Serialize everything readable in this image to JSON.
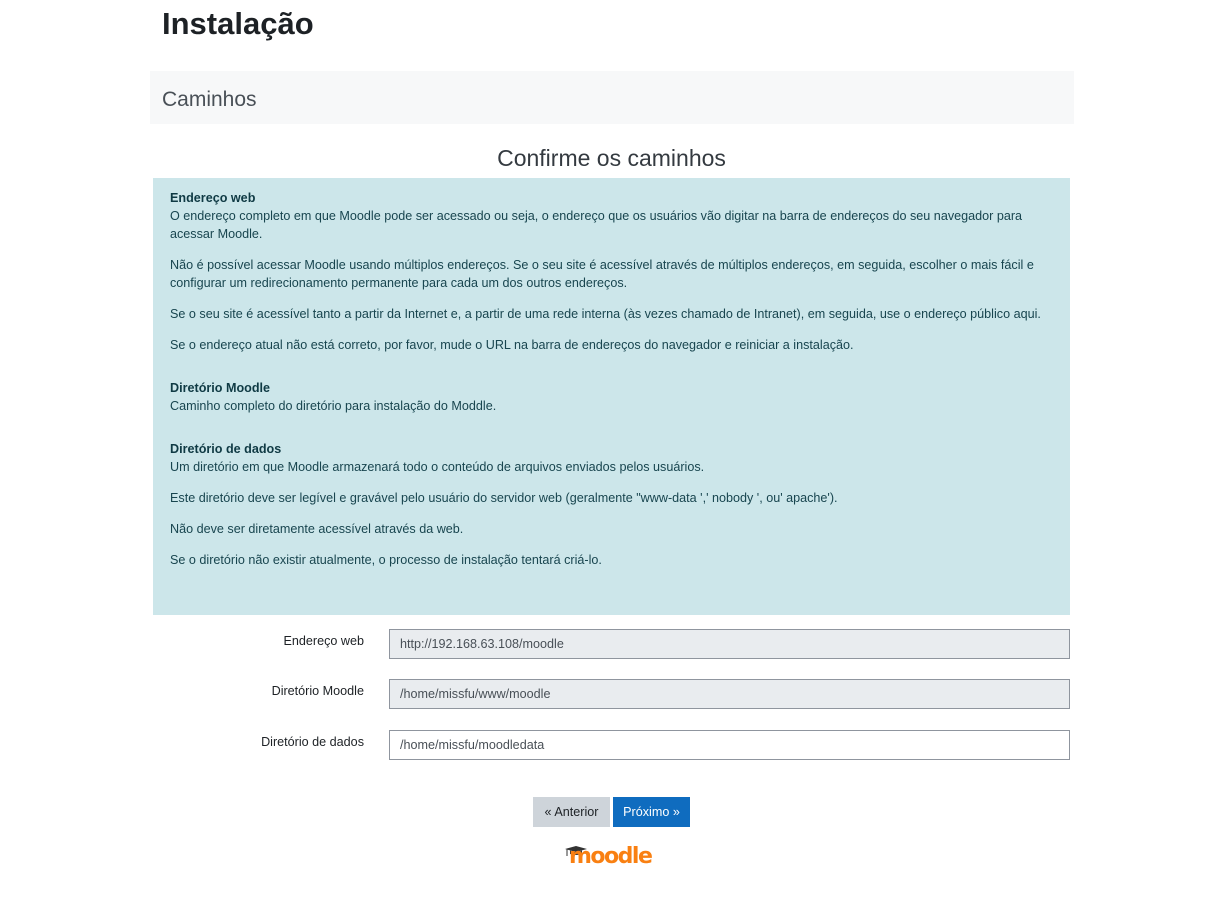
{
  "page": {
    "title": "Instalação"
  },
  "stage": {
    "title": "Caminhos"
  },
  "confirm": {
    "heading": "Confirme os caminhos"
  },
  "info": {
    "web": {
      "title": "Endereço web",
      "paragraphs": [
        "O endereço completo em que Moodle pode ser acessado ou seja, o endereço que os usuários vão digitar na barra de endereços do seu navegador para acessar Moodle.",
        "Não é possível acessar Moodle usando múltiplos endereços. Se o seu site é acessível através de múltiplos endereços, em seguida, escolher o mais fácil e configurar um redirecionamento permanente para cada um dos outros endereços.",
        "Se o seu site é acessível tanto a partir da Internet e, a partir de uma rede interna (às vezes chamado de Intranet), em seguida, use o endereço público aqui.",
        "Se o endereço atual não está correto, por favor, mude o URL na barra de endereços do navegador e reiniciar a instalação."
      ]
    },
    "dirroot": {
      "title": "Diretório Moodle",
      "paragraphs": [
        "Caminho completo do diretório para instalação do Moddle."
      ]
    },
    "dataroot": {
      "title": "Diretório de dados",
      "paragraphs": [
        "Um diretório em que Moodle armazenará todo o conteúdo de arquivos enviados pelos usuários.",
        "Este diretório deve ser legível e gravável pelo usuário do servidor web (geralmente \"www-data ',' nobody ', ou' apache').",
        "Não deve ser diretamente acessível através da web.",
        "Se o diretório não existir atualmente, o processo de instalação tentará criá-lo."
      ]
    }
  },
  "form": {
    "wwwroot": {
      "label": "Endereço web",
      "value": "http://192.168.63.108/moodle"
    },
    "dirroot": {
      "label": "Diretório Moodle",
      "value": "/home/missfu/www/moodle"
    },
    "dataroot": {
      "label": "Diretório de dados",
      "value": "/home/missfu/moodledata"
    }
  },
  "buttons": {
    "previous": "« Anterior",
    "next": "Próximo »"
  },
  "logo": {
    "text": "moodle",
    "color": "#f98012",
    "hat_color": "#333333"
  }
}
